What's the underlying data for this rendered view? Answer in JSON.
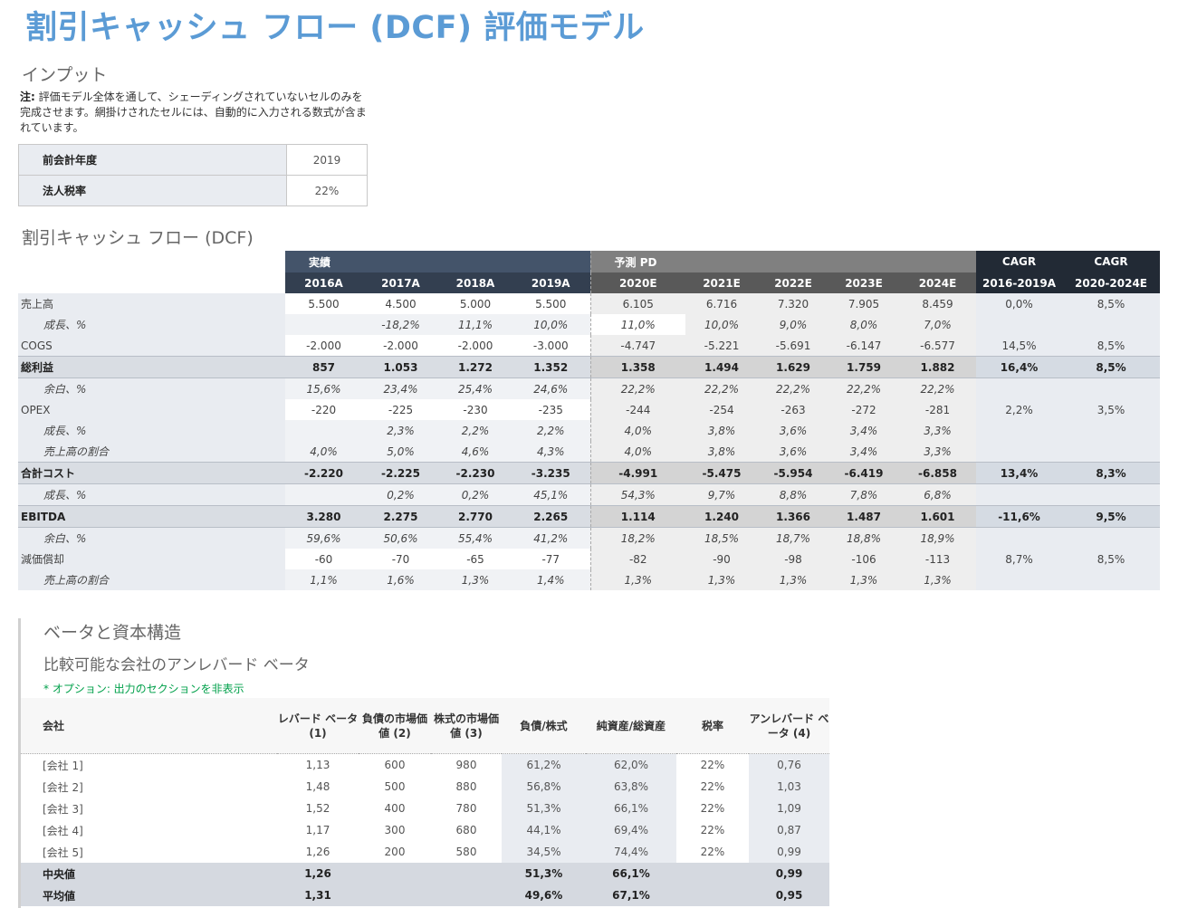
{
  "title": "割引キャッシュ フロー (DCF) 評価モデル",
  "inputs": {
    "heading": "インプット",
    "note_bold": "注:",
    "note_text": " 評価モデル全体を通して、シェーディングされていないセルのみを完成させます。網掛けされたセルには、自動的に入力される数式が含まれています。",
    "rows": [
      {
        "label": "前会計年度",
        "value": "2019"
      },
      {
        "label": "法人税率",
        "value": "22%"
      }
    ]
  },
  "dcf": {
    "heading": "割引キャッシュ フロー (DCF)",
    "group_actual": "実績",
    "group_forecast": "予測 PD",
    "cagr1": "CAGR",
    "cagr2": "CAGR",
    "years": [
      "2016A",
      "2017A",
      "2018A",
      "2019A",
      "2020E",
      "2021E",
      "2022E",
      "2023E",
      "2024E",
      "2016-2019A",
      "2020-2024E"
    ],
    "rows": [
      {
        "label": "売上高",
        "style": "input",
        "values": [
          "5.500",
          "4.500",
          "5.000",
          "5.500",
          "6.105",
          "6.716",
          "7.320",
          "7.905",
          "8.459",
          "0,0%",
          "8,5%"
        ]
      },
      {
        "label": "成長、%",
        "style": "sub",
        "values": [
          "",
          "-18,2%",
          "11,1%",
          "10,0%",
          "11,0%",
          "10,0%",
          "9,0%",
          "8,0%",
          "7,0%",
          "",
          ""
        ]
      },
      {
        "label": "COGS",
        "style": "input",
        "values": [
          "-2.000",
          "-2.000",
          "-2.000",
          "-3.000",
          "-4.747",
          "-5.221",
          "-5.691",
          "-6.147",
          "-6.577",
          "14,5%",
          "8,5%"
        ]
      },
      {
        "label": "総利益",
        "style": "bold",
        "values": [
          "857",
          "1.053",
          "1.272",
          "1.352",
          "1.358",
          "1.494",
          "1.629",
          "1.759",
          "1.882",
          "16,4%",
          "8,5%"
        ]
      },
      {
        "label": "余白、%",
        "style": "sub",
        "values": [
          "15,6%",
          "23,4%",
          "25,4%",
          "24,6%",
          "22,2%",
          "22,2%",
          "22,2%",
          "22,2%",
          "22,2%",
          "",
          ""
        ]
      },
      {
        "label": "OPEX",
        "style": "input",
        "values": [
          "-220",
          "-225",
          "-230",
          "-235",
          "-244",
          "-254",
          "-263",
          "-272",
          "-281",
          "2,2%",
          "3,5%"
        ]
      },
      {
        "label": "成長、%",
        "style": "sub",
        "values": [
          "",
          "2,3%",
          "2,2%",
          "2,2%",
          "4,0%",
          "3,8%",
          "3,6%",
          "3,4%",
          "3,3%",
          "",
          ""
        ]
      },
      {
        "label": "売上高の割合",
        "style": "sub",
        "values": [
          "4,0%",
          "5,0%",
          "4,6%",
          "4,3%",
          "4,0%",
          "3,8%",
          "3,6%",
          "3,4%",
          "3,3%",
          "",
          ""
        ]
      },
      {
        "label": "合計コスト",
        "style": "bold",
        "values": [
          "-2.220",
          "-2.225",
          "-2.230",
          "-3.235",
          "-4.991",
          "-5.475",
          "-5.954",
          "-6.419",
          "-6.858",
          "13,4%",
          "8,3%"
        ]
      },
      {
        "label": "成長、%",
        "style": "sub",
        "values": [
          "",
          "0,2%",
          "0,2%",
          "45,1%",
          "54,3%",
          "9,7%",
          "8,8%",
          "7,8%",
          "6,8%",
          "",
          ""
        ]
      },
      {
        "label": "EBITDA",
        "style": "bold",
        "values": [
          "3.280",
          "2.275",
          "2.770",
          "2.265",
          "1.114",
          "1.240",
          "1.366",
          "1.487",
          "1.601",
          "-11,6%",
          "9,5%"
        ]
      },
      {
        "label": "余白、%",
        "style": "sub",
        "values": [
          "59,6%",
          "50,6%",
          "55,4%",
          "41,2%",
          "18,2%",
          "18,5%",
          "18,7%",
          "18,8%",
          "18,9%",
          "",
          ""
        ]
      },
      {
        "label": "減価償却",
        "style": "input",
        "values": [
          "-60",
          "-70",
          "-65",
          "-77",
          "-82",
          "-90",
          "-98",
          "-106",
          "-113",
          "8,7%",
          "8,5%"
        ]
      },
      {
        "label": "売上高の割合",
        "style": "sub",
        "values": [
          "1,1%",
          "1,6%",
          "1,3%",
          "1,4%",
          "1,3%",
          "1,3%",
          "1,3%",
          "1,3%",
          "1,3%",
          "",
          ""
        ]
      }
    ]
  },
  "beta": {
    "heading": "ベータと資本構造",
    "subheading": "比較可能な会社のアンレバード ベータ",
    "option_note": "* オプション: 出力のセクションを非表示",
    "columns": [
      "会社",
      "レバード ベータ (1)",
      "負債の市場価値 (2)",
      "株式の市場価値 (3)",
      "負債/株式",
      "純資産/総資産",
      "税率",
      "アンレバード ベータ (4)"
    ],
    "rows": [
      [
        "[会社 1]",
        "1,13",
        "600",
        "980",
        "61,2%",
        "62,0%",
        "22%",
        "0,76"
      ],
      [
        "[会社 2]",
        "1,48",
        "500",
        "880",
        "56,8%",
        "63,8%",
        "22%",
        "1,03"
      ],
      [
        "[会社 3]",
        "1,52",
        "400",
        "780",
        "51,3%",
        "66,1%",
        "22%",
        "1,09"
      ],
      [
        "[会社 4]",
        "1,17",
        "300",
        "680",
        "44,1%",
        "69,4%",
        "22%",
        "0,87"
      ],
      [
        "[会社 5]",
        "1,26",
        "200",
        "580",
        "34,5%",
        "74,4%",
        "22%",
        "0,99"
      ]
    ],
    "summary": [
      [
        "中央値",
        "1,26",
        "",
        "",
        "51,3%",
        "66,1%",
        "",
        "0,99"
      ],
      [
        "平均値",
        "1,31",
        "",
        "",
        "49,6%",
        "67,1%",
        "",
        "0,95"
      ]
    ]
  }
}
